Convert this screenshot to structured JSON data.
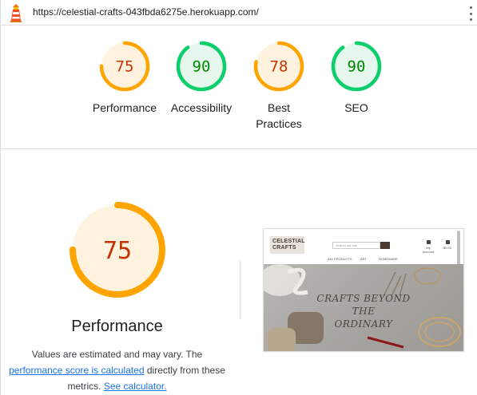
{
  "header": {
    "url": "https://celestial-crafts-043fbda6275e.herokuapp.com/",
    "logo_icon": "lighthouse-icon",
    "menu_icon": "kebab-menu-icon"
  },
  "colors": {
    "average_orange": "#ffa400",
    "average_text": "#c33300",
    "average_bg": "#fff3e0",
    "pass_green": "#0cce6b",
    "pass_text": "#008800",
    "pass_bg": "#e6f8ee",
    "link_blue": "#1a73e8"
  },
  "scores": [
    {
      "label_lines": [
        "Performance"
      ],
      "score": "75",
      "value": 75,
      "rating": "average"
    },
    {
      "label_lines": [
        "Accessibility"
      ],
      "score": "90",
      "value": 90,
      "rating": "pass"
    },
    {
      "label_lines": [
        "Best",
        "Practices"
      ],
      "score": "78",
      "value": 78,
      "rating": "average"
    },
    {
      "label_lines": [
        "SEO"
      ],
      "score": "90",
      "value": 90,
      "rating": "pass"
    }
  ],
  "performance": {
    "score": "75",
    "value": 75,
    "title": "Performance",
    "desc_text_1": "Values are estimated and may vary. The",
    "link_score": "performance score is calculated",
    "desc_text_2": "directly from these",
    "desc_text_3": "metrics.",
    "link_calc": "See calculator."
  },
  "screenshot": {
    "logo_line1": "CELESTIAL",
    "logo_line2": "CRAFTS",
    "search_placeholder": "Search our site",
    "icon_labels": [
      "My Account",
      "$0.00"
    ],
    "nav_items": [
      "ALL PRODUCTS",
      "ART",
      "HOMEWARE"
    ],
    "hero_line1": "CRAFTS BEYOND",
    "hero_line2": "THE",
    "hero_line3": "ORDINARY"
  }
}
